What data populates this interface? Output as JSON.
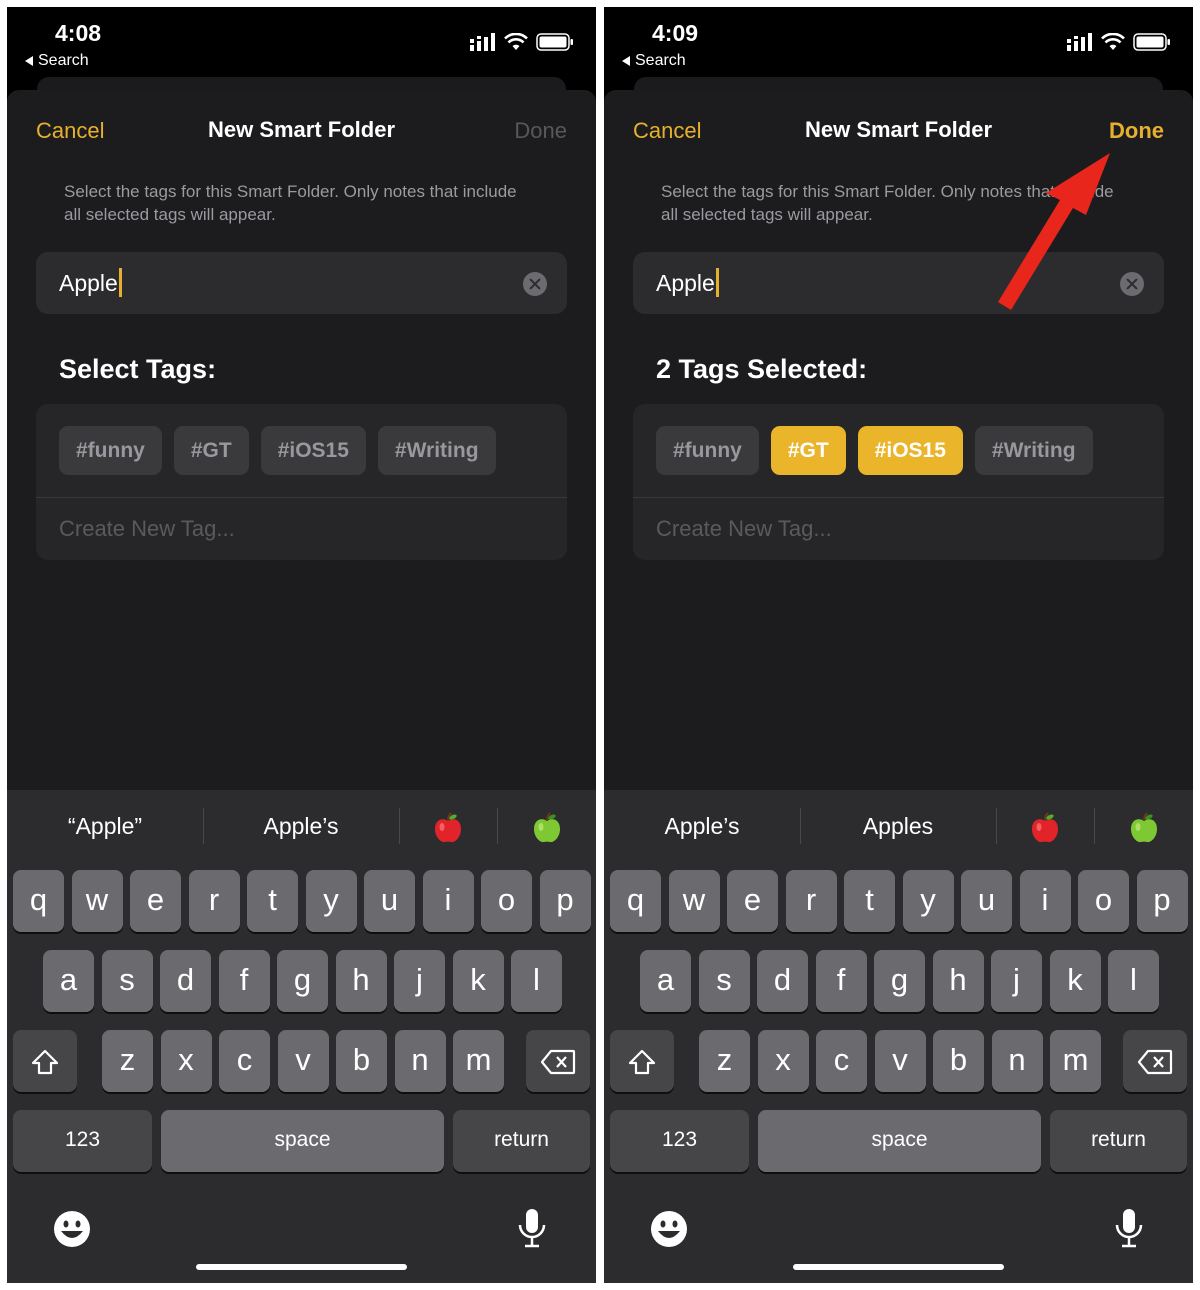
{
  "panels": [
    {
      "status": {
        "time": "4:08",
        "back_label": "Search"
      },
      "nav": {
        "cancel": "Cancel",
        "title": "New Smart Folder",
        "done": "Done"
      },
      "description": "Select the tags for this Smart Folder. Only notes that include all selected tags will appear.",
      "search": {
        "value": "Apple"
      },
      "section_title": "Select Tags:",
      "tags": [
        {
          "label": "#funny",
          "selected": false
        },
        {
          "label": "#GT",
          "selected": false
        },
        {
          "label": "#iOS15",
          "selected": false
        },
        {
          "label": "#Writing",
          "selected": false
        }
      ],
      "create_tag_placeholder": "Create New Tag...",
      "suggestions": [
        "“Apple”",
        "Apple’s",
        "red-apple-emoji",
        "green-apple-emoji"
      ]
    },
    {
      "status": {
        "time": "4:09",
        "back_label": "Search"
      },
      "nav": {
        "cancel": "Cancel",
        "title": "New Smart Folder",
        "done": "Done"
      },
      "description": "Select the tags for this Smart Folder. Only notes that include all selected tags will appear.",
      "search": {
        "value": "Apple"
      },
      "section_title": "2 Tags Selected:",
      "tags": [
        {
          "label": "#funny",
          "selected": false
        },
        {
          "label": "#GT",
          "selected": true
        },
        {
          "label": "#iOS15",
          "selected": true
        },
        {
          "label": "#Writing",
          "selected": false
        }
      ],
      "create_tag_placeholder": "Create New Tag...",
      "suggestions": [
        "Apple’s",
        "Apples",
        "red-apple-emoji",
        "green-apple-emoji"
      ]
    }
  ],
  "keyboard": {
    "row1": [
      "q",
      "w",
      "e",
      "r",
      "t",
      "y",
      "u",
      "i",
      "o",
      "p"
    ],
    "row2": [
      "a",
      "s",
      "d",
      "f",
      "g",
      "h",
      "j",
      "k",
      "l"
    ],
    "row3": [
      "z",
      "x",
      "c",
      "v",
      "b",
      "n",
      "m"
    ],
    "numbers": "123",
    "space": "space",
    "return": "return"
  },
  "colors": {
    "accent": "#e6b02e",
    "selected_tag": "#eab52a",
    "annotation_arrow": "#e8261c"
  }
}
